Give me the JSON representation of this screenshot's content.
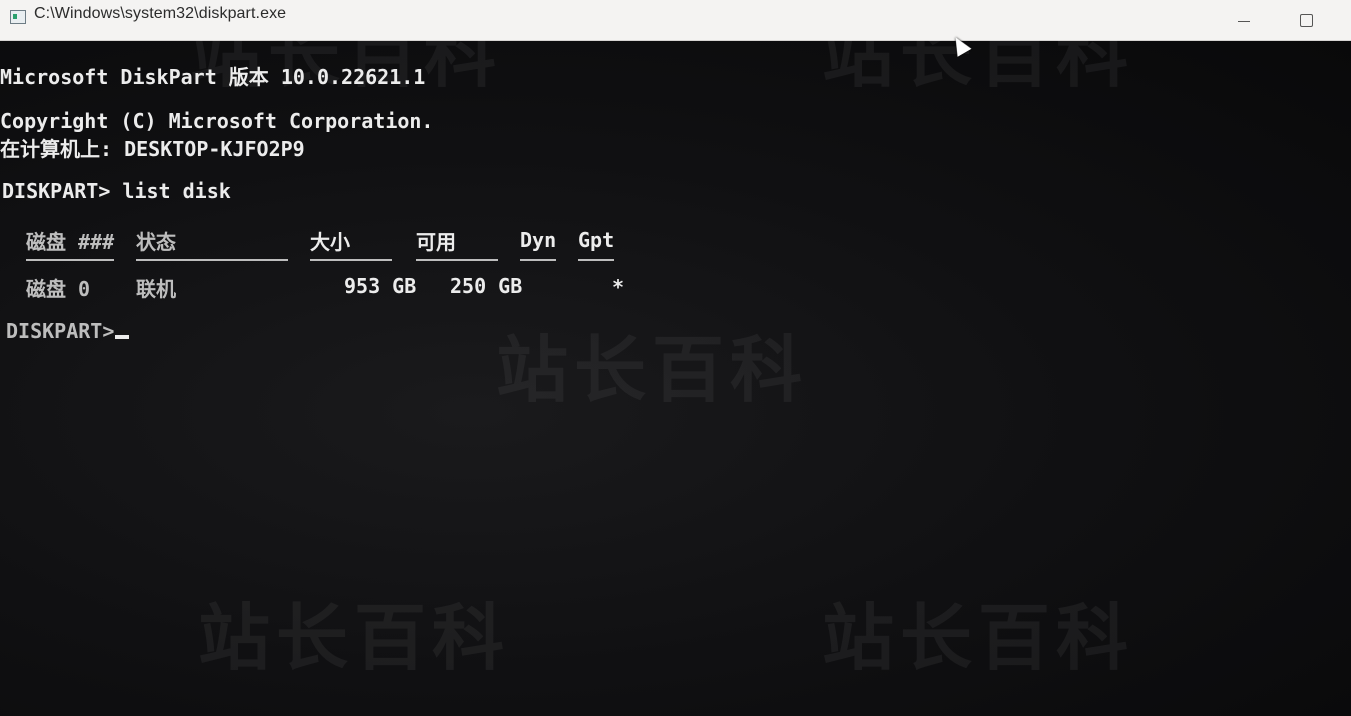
{
  "window": {
    "title": "C:\\Windows\\system32\\diskpart.exe"
  },
  "console": {
    "banner": "Microsoft DiskPart 版本 10.0.22621.1",
    "copyright": "Copyright (C) Microsoft Corporation.",
    "computer": "在计算机上: DESKTOP-KJFO2P9",
    "command_line": "DISKPART> list disk",
    "table": {
      "headers": {
        "disk": "磁盘 ###",
        "status": "状态",
        "size": "大小",
        "free": "可用",
        "dyn": "Dyn",
        "gpt": "Gpt"
      },
      "rows": [
        {
          "disk": "磁盘 0",
          "status": "联机",
          "size": "953 GB",
          "free": "250 GB",
          "dyn": "",
          "gpt": "*"
        }
      ]
    },
    "prompt": "DISKPART>"
  },
  "watermark": "站长百科"
}
